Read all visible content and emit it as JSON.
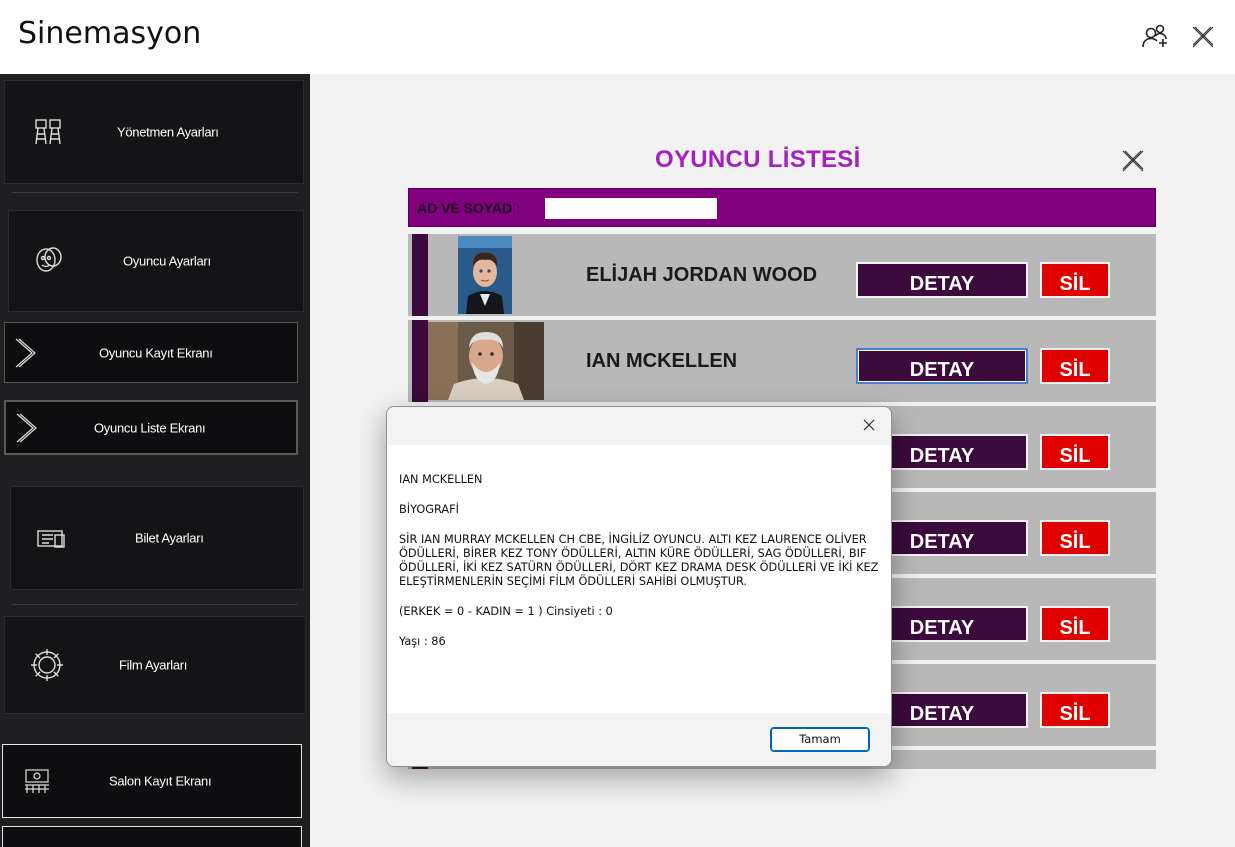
{
  "app": {
    "title": "Sinemasyon",
    "icons": {
      "add_user": "add-user-icon",
      "close": "close-icon"
    }
  },
  "sidebar": {
    "items": [
      {
        "label": "Yönetmen Ayarları",
        "icon": "director-icon"
      },
      {
        "label": "Oyuncu Ayarları",
        "icon": "actor-mask-icon"
      },
      {
        "label": "Oyuncu Kayıt Ekranı",
        "icon": "chevron-right-icon"
      },
      {
        "label": "Oyuncu Liste Ekranı",
        "icon": "chevron-right-icon"
      },
      {
        "label": "Bilet Ayarları",
        "icon": "ticket-icon"
      },
      {
        "label": "Film Ayarları",
        "icon": "gear-icon"
      },
      {
        "label": "Salon Kayıt Ekranı",
        "icon": "cinema-hall-icon"
      }
    ]
  },
  "actor_list": {
    "title": "OYUNCU LİSTESİ",
    "search_label": "AD VE SOYAD :",
    "search_value": "",
    "detail_label": "DETAY",
    "delete_label": "SİL",
    "rows": [
      {
        "name": "ELİJAH JORDAN WOOD"
      },
      {
        "name": "IAN MCKELLEN"
      },
      {
        "name": ""
      },
      {
        "name": ""
      },
      {
        "name": ""
      },
      {
        "name": ""
      }
    ]
  },
  "colors": {
    "title": "#a61fbf",
    "search_bar": "#800080",
    "detay_button": "#3c0a3c",
    "sil_button": "#e10000",
    "row_background": "#b8b8b8",
    "sidebar": "#1f1f22"
  },
  "dialog": {
    "name": "IAN MCKELLEN",
    "bio_heading": "BİYOGRAFİ",
    "bio": "SİR IAN MURRAY MCKELLEN CH CBE, İNGİLİZ OYUNCU. ALTI KEZ LAURENCE OLİVER ÖDÜLLERİ, BİRER KEZ TONY ÖDÜLLERİ, ALTIN KÜRE ÖDÜLLERİ, SAG ÖDÜLLERİ, BIF ÖDÜLLERİ, İKİ KEZ SATÜRN ÖDÜLLERİ, DÖRT KEZ DRAMA DESK ÖDÜLLERİ VE İKİ KEZ ELEŞTİRMENLERİN SEÇİMİ FİLM ÖDÜLLERİ SAHİBİ OLMUŞTUR.",
    "gender_line": "(ERKEK = 0 - KADIN = 1 ) Cinsiyeti : 0",
    "age_line": "Yaşı : 86",
    "ok_label": "Tamam"
  }
}
